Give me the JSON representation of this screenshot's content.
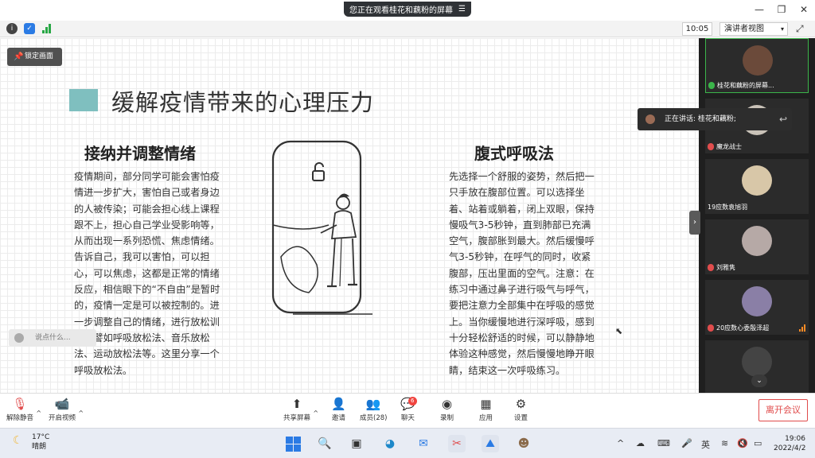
{
  "window": {
    "share_banner": "您正在观看桂花和藕粉的屏幕",
    "controls": {
      "minimize": "—",
      "restore": "❐",
      "close": "✕"
    }
  },
  "toolbar": {
    "time": "10:05",
    "view_mode": "演讲者视图",
    "view_caret": "▾"
  },
  "slide": {
    "lock_label": "锁定画面",
    "title": "缓解疫情带来的心理压力",
    "left_heading": "接纳并调整情绪",
    "left_body": "疫情期间，部分同学可能会害怕疫情进一步扩大，害怕自己或者身边的人被传染；可能会担心线上课程跟不上，担心自己学业受影响等，从而出现一系列恐慌、焦虑情绪。告诉自己，我可以害怕，可以担心，可以焦虑，这都是正常的情绪反应，相信眼下的“不自由”是暂时的，疫情一定是可以被控制的。进一步调整自己的情绪，进行放松训练，譬如呼吸放松法、音乐放松法、运动放松法等。这里分享一个呼吸放松法。",
    "right_heading": "腹式呼吸法",
    "right_body": "先选择一个舒服的姿势，然后把一只手放在腹部位置。可以选择坐着、站着或躺着，闭上双眼，保持慢吸气3-5秒钟，直到肺部已充满空气，腹部胀到最大。然后缓慢呼气3-5秒钟，在呼气的同时，收紧腹部，压出里面的空气。注意：在练习中通过鼻子进行吸气与呼气，要把注意力全部集中在呼吸的感觉上。当你缓慢地进行深呼吸，感到十分轻松舒适的时候，可以静静地体验这种感觉，然后慢慢地睁开眼睛，结束这一次呼吸练习。",
    "chat_placeholder": "说点什么..."
  },
  "speaking": {
    "label": "正在讲话: 桂花和藕粉;"
  },
  "participants": [
    {
      "name": "桂花和藕粉的屏幕...",
      "avatar_color": "#6b4a3a",
      "active": true
    },
    {
      "name": "魔龙战士",
      "avatar_color": "#c9c2b8",
      "active": false
    },
    {
      "name": "19应数袁旭羽",
      "avatar_color": "#d8c7a8",
      "active": false
    },
    {
      "name": "刘雅隽",
      "avatar_color": "#b6a9a6",
      "active": false
    },
    {
      "name": "20应数心委殷泽超",
      "avatar_color": "#8a7fa6",
      "active": false
    },
    {
      "name": "",
      "avatar_color": "#444444",
      "active": false
    }
  ],
  "meetbar": {
    "mute": "解除静音",
    "video": "开启视频",
    "share": "共享屏幕",
    "invite": "邀请",
    "members": "成员(28)",
    "chat": "聊天",
    "chat_badge": "6",
    "record": "录制",
    "apps": "应用",
    "settings": "设置",
    "leave": "离开会议"
  },
  "taskbar": {
    "temp": "17°C",
    "weather": "晴朗",
    "ime": "英",
    "time": "19:06",
    "date": "2022/4/2"
  }
}
